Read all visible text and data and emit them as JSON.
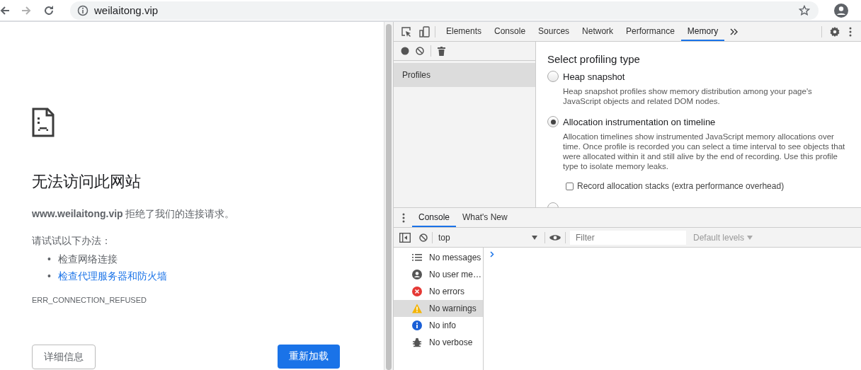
{
  "browser": {
    "url": "weilaitong.vip"
  },
  "error_page": {
    "title": "无法访问此网站",
    "message": "**www.weilaitong.vip** 拒绝了我们的连接请求。",
    "suggestions_heading": "请试试以下办法：",
    "suggestions": [
      {
        "marker": "•",
        "text": "检查网络连接",
        "kind": "text"
      },
      {
        "marker": "•",
        "text": "检查代理服务器和防火墙",
        "kind": "link"
      }
    ],
    "error_code": "ERR_CONNECTION_REFUSED",
    "buttons": [
      {
        "label": "详细信息",
        "kind": "secondary"
      },
      {
        "label": "重新加载",
        "kind": "primary"
      }
    ]
  },
  "devtools": {
    "tabs": [
      {
        "label": "Elements",
        "selected": false
      },
      {
        "label": "Console",
        "selected": false
      },
      {
        "label": "Sources",
        "selected": false
      },
      {
        "label": "Network",
        "selected": false
      },
      {
        "label": "Performance",
        "selected": false
      },
      {
        "label": "Memory",
        "selected": true
      }
    ],
    "memory": {
      "sidebar_items": [
        {
          "label": "Profiles",
          "selected": true
        }
      ],
      "heading": "Select profiling type",
      "options": [
        {
          "label": "Heap snapshot",
          "description": "Heap snapshot profiles show memory distribution among your page's JavaScript objects and related DOM nodes.",
          "selected": false
        },
        {
          "label": "Allocation instrumentation on timeline",
          "description": "Allocation timelines show instrumented JavaScript memory allocations over time. Once profile is recorded you can select a time interval to see objects that were allocated within it and still alive by the end of recording. Use this profile type to isolate memory leaks.",
          "selected": true,
          "checkbox": {
            "label": "Record allocation stacks (extra performance overhead)",
            "checked": false
          }
        },
        {
          "selected": false
        }
      ]
    },
    "drawer": {
      "tabs": [
        {
          "label": "Console",
          "selected": true
        },
        {
          "label": "What's New",
          "selected": false
        }
      ],
      "context": "top",
      "filter": {
        "placeholder": "Filter"
      },
      "levels": "Default levels",
      "sidebar": [
        {
          "label": "No messages",
          "kind": "messages",
          "selected": false
        },
        {
          "label": "No user me…",
          "kind": "user",
          "selected": false
        },
        {
          "label": "No errors",
          "kind": "error",
          "selected": false
        },
        {
          "label": "No warnings",
          "kind": "warning",
          "selected": true
        },
        {
          "label": "No info",
          "kind": "info",
          "selected": false
        },
        {
          "label": "No verbose",
          "kind": "verbose",
          "selected": false
        }
      ]
    }
  }
}
